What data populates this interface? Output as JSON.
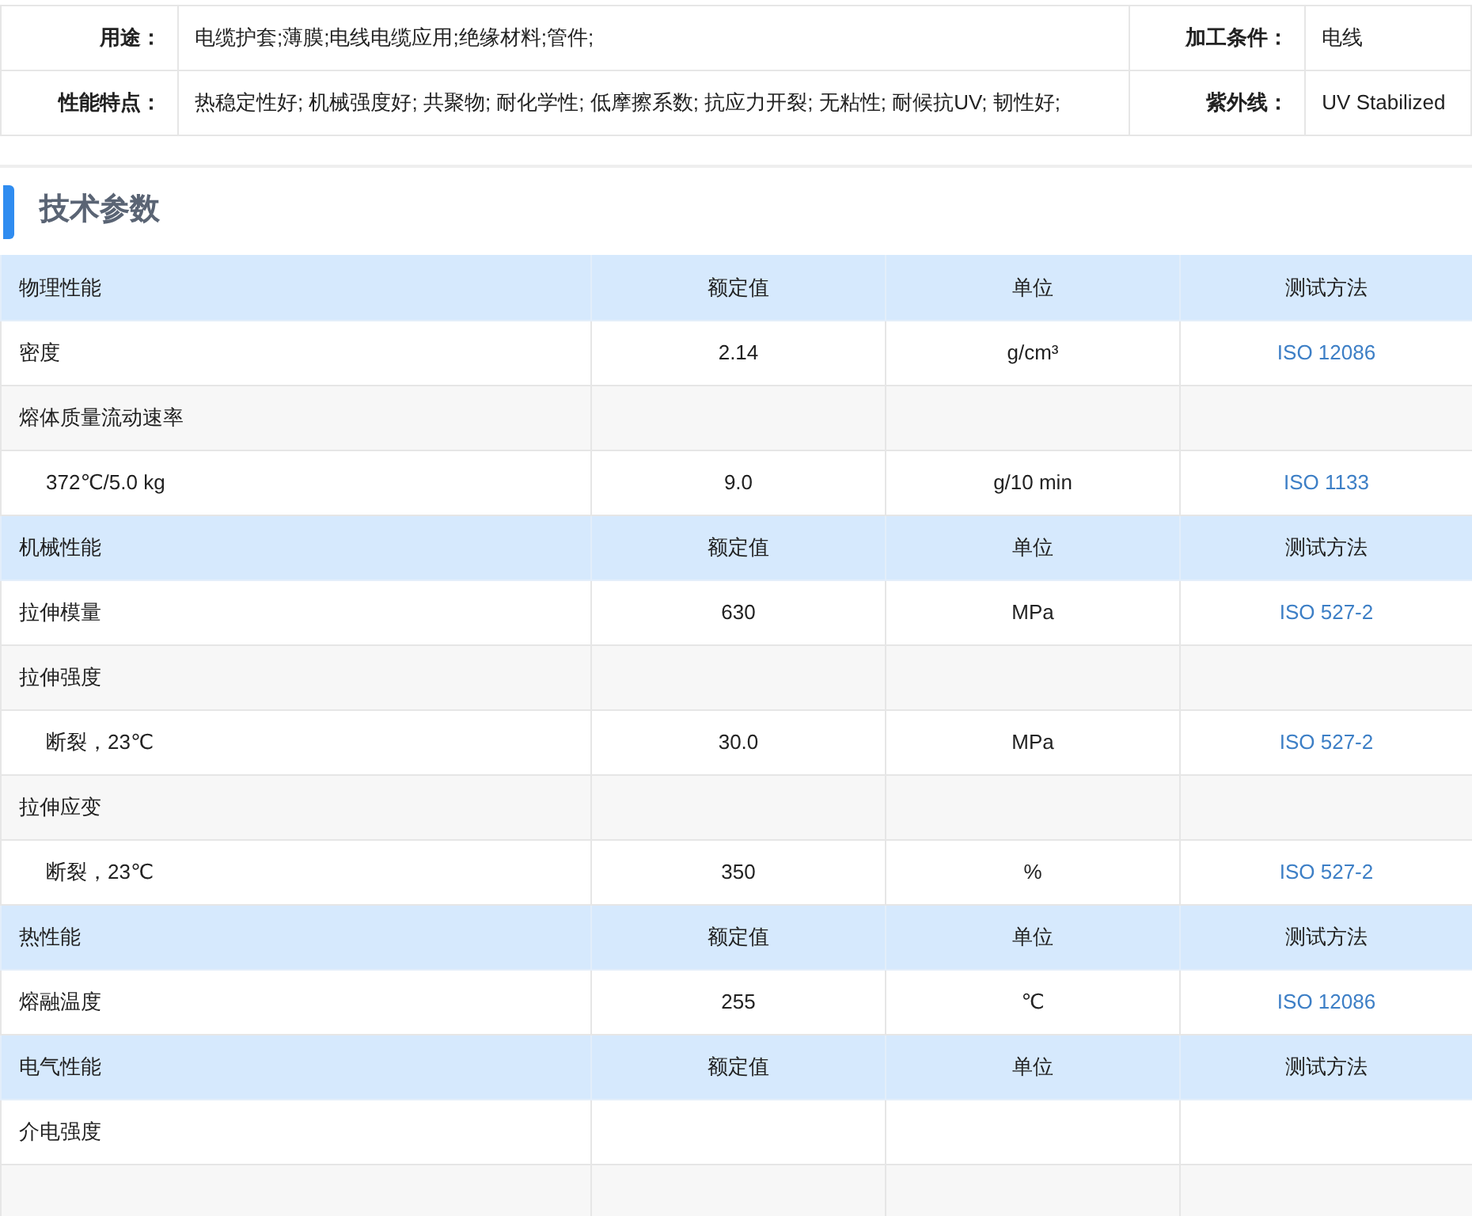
{
  "info": [
    {
      "label": "用途：",
      "value": "电缆护套;薄膜;电线电缆应用;绝缘材料;管件;",
      "label_2": "加工条件：",
      "value_2": "电线"
    },
    {
      "label": "性能特点：",
      "value": "热稳定性好; 机械强度好; 共聚物; 耐化学性; 低摩擦系数; 抗应力开裂; 无粘性; 耐候抗UV; 韧性好;",
      "label_2": "紫外线：",
      "value_2": "UV Stabilized"
    }
  ],
  "section_title": "技术参数",
  "groups": [
    {
      "name": "物理性能",
      "columns": [
        "额定值",
        "单位",
        "测试方法"
      ],
      "rows": [
        {
          "kind": "property",
          "name": "密度",
          "value": "2.14",
          "unit": "g/cm³",
          "method": "ISO 12086"
        },
        {
          "kind": "property",
          "name": "熔体质量流动速率"
        },
        {
          "kind": "condition",
          "name": "372℃/5.0 kg",
          "value": "9.0",
          "unit": "g/10 min",
          "method": "ISO 1133"
        }
      ]
    },
    {
      "name": "机械性能",
      "columns": [
        "额定值",
        "单位",
        "测试方法"
      ],
      "rows": [
        {
          "kind": "property",
          "name": "拉伸模量",
          "value": "630",
          "unit": "MPa",
          "method": "ISO 527-2"
        },
        {
          "kind": "property",
          "name": "拉伸强度"
        },
        {
          "kind": "condition",
          "name": "断裂，23℃",
          "value": "30.0",
          "unit": "MPa",
          "method": "ISO 527-2"
        },
        {
          "kind": "property",
          "name": "拉伸应变"
        },
        {
          "kind": "condition",
          "name": "断裂，23℃",
          "value": "350",
          "unit": "%",
          "method": "ISO 527-2"
        }
      ]
    },
    {
      "name": "热性能",
      "columns": [
        "额定值",
        "单位",
        "测试方法"
      ],
      "rows": [
        {
          "kind": "property",
          "name": "熔融温度",
          "value": "255",
          "unit": "℃",
          "method": "ISO 12086"
        }
      ]
    },
    {
      "name": "电气性能",
      "columns": [
        "额定值",
        "单位",
        "测试方法"
      ],
      "rows": [
        {
          "kind": "property",
          "name": "介电强度"
        }
      ]
    }
  ]
}
